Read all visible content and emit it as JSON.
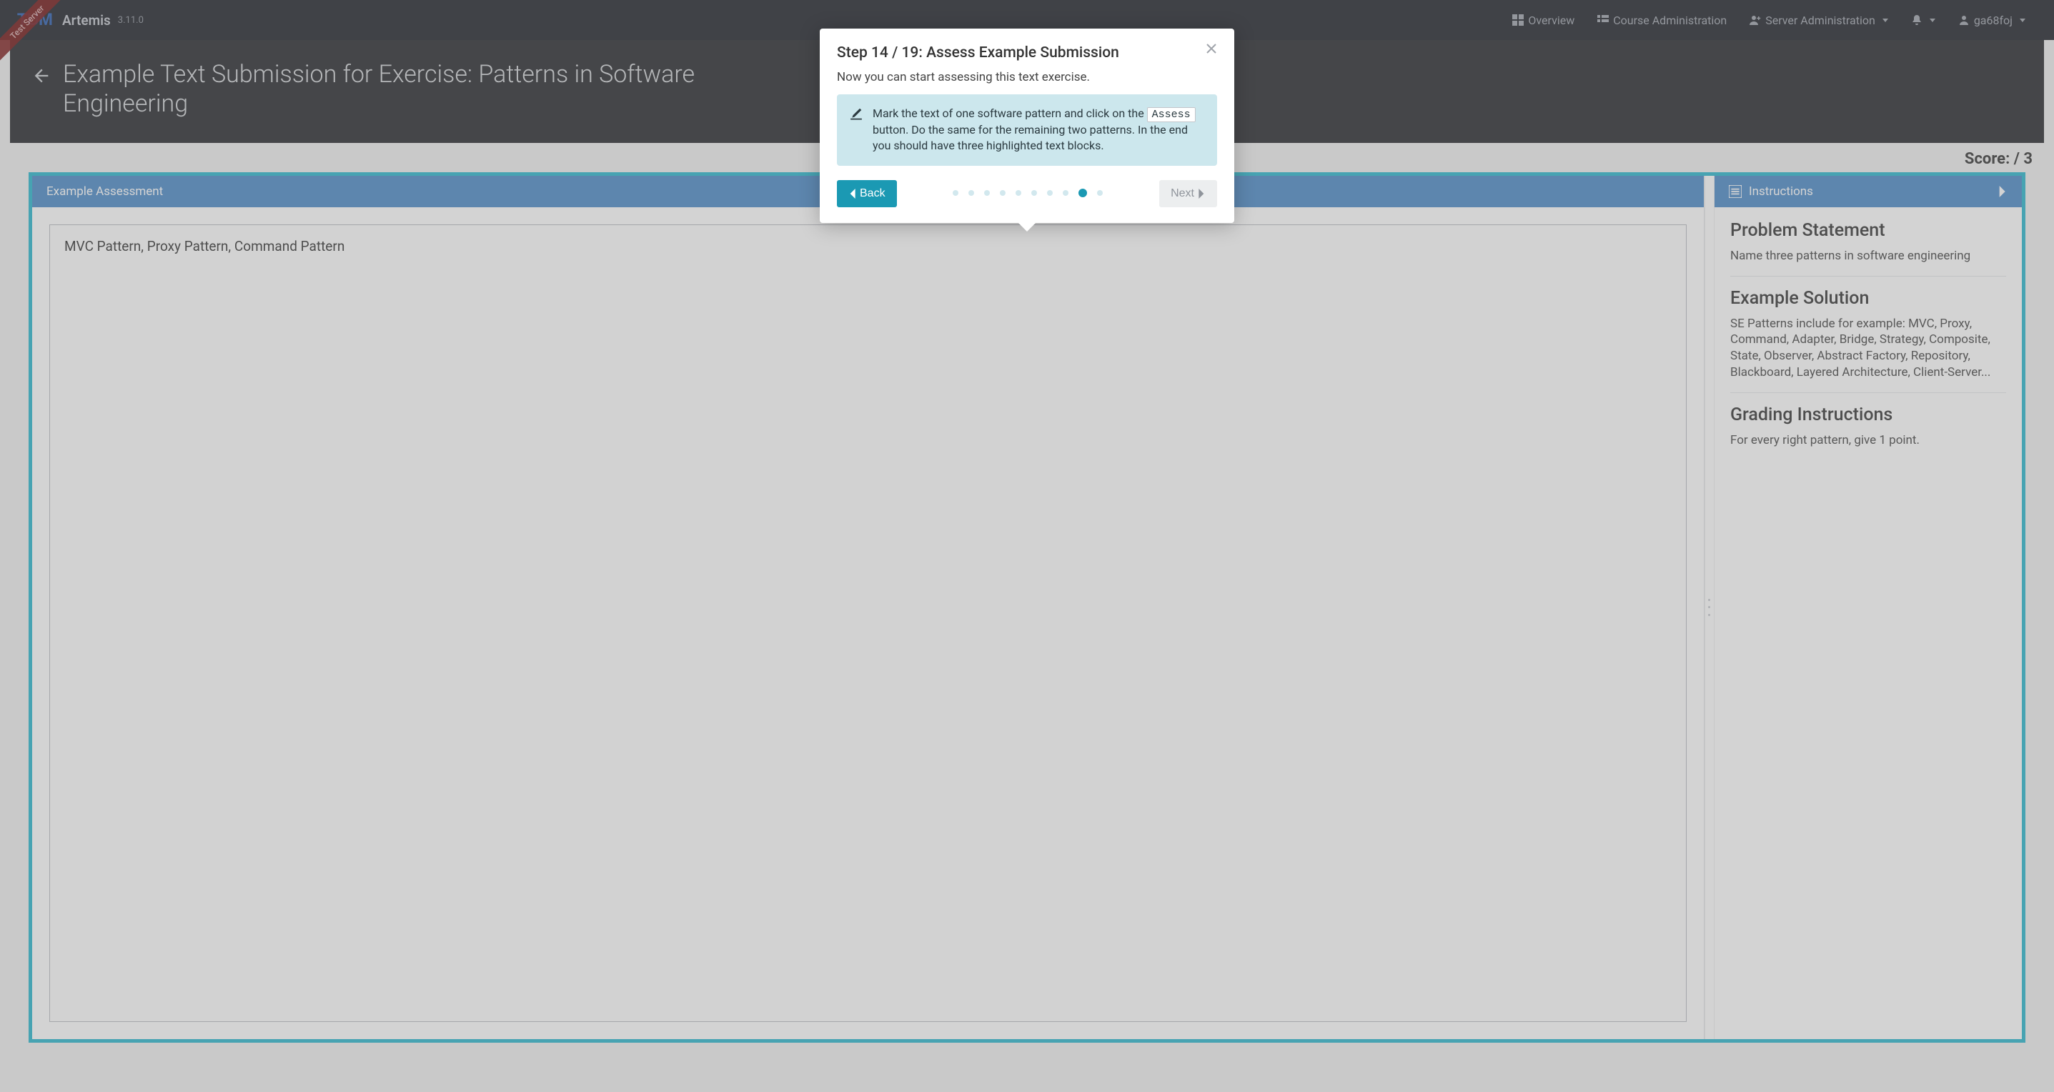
{
  "ribbon": "Test Server",
  "nav": {
    "logo": "TUM",
    "brand": "Artemis",
    "version": "3.11.0",
    "items": {
      "overview": "Overview",
      "course_admin": "Course Administration",
      "server_admin": "Server Administration",
      "user": "ga68foj"
    }
  },
  "page": {
    "title_line1": "Example Text Submission for Exercise: Patterns in Software",
    "title_line2": "Engineering",
    "score_label": "Score:",
    "score_total": "/ 3"
  },
  "left_pane": {
    "header": "Example Assessment",
    "text": "MVC Pattern, Proxy Pattern, Command Pattern"
  },
  "right_pane": {
    "header": "Instructions",
    "problem_h": "Problem Statement",
    "problem_p": "Name three patterns in software engineering",
    "solution_h": "Example Solution",
    "solution_p": "SE Patterns include for example: MVC, Proxy, Command, Adapter, Bridge, Strategy, Composite, State, Observer, Abstract Factory, Repository, Blackboard, Layered Architecture, Client-Server...",
    "grading_h": "Grading Instructions",
    "grading_p": "For every right pattern, give 1 point."
  },
  "tour": {
    "title": "Step 14 / 19: Assess Example Submission",
    "subtitle": "Now you can start assessing this text exercise.",
    "callout_pre": "Mark the text of one software pattern and click on the ",
    "callout_kbd": "Assess",
    "callout_post": " button. Do the same for the remaining two patterns. In the end you should have three highlighted text blocks.",
    "back": "Back",
    "next": "Next",
    "dots_total": 10,
    "dot_active_index": 8
  }
}
